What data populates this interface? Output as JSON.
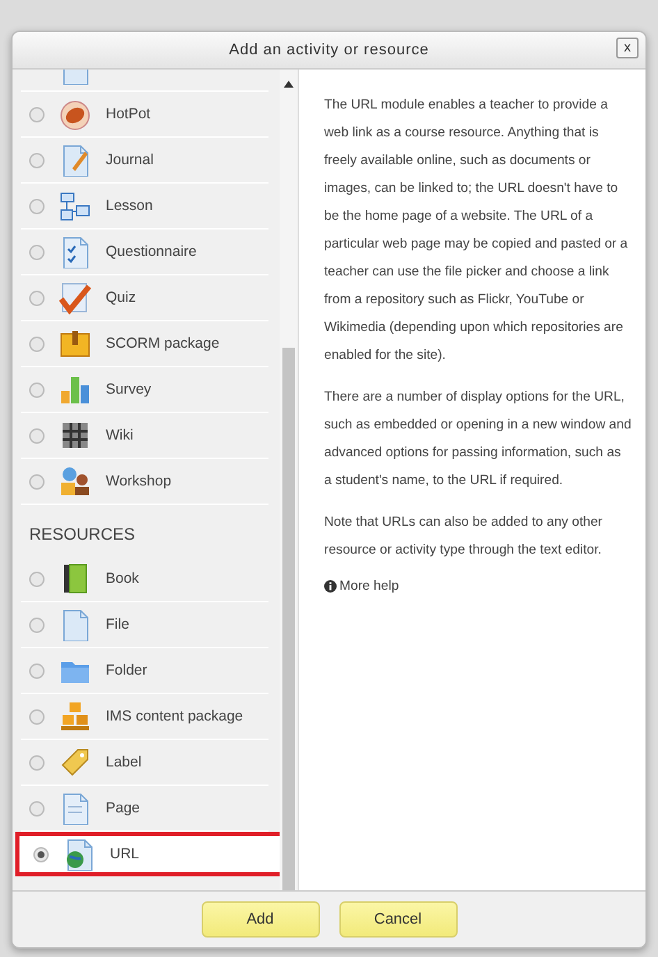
{
  "dialog": {
    "title": "Add an activity or resource",
    "close": "x"
  },
  "activities": {
    "items": [
      {
        "label": "HotPot",
        "selected": false
      },
      {
        "label": "Journal",
        "selected": false
      },
      {
        "label": "Lesson",
        "selected": false
      },
      {
        "label": "Questionnaire",
        "selected": false
      },
      {
        "label": "Quiz",
        "selected": false
      },
      {
        "label": "SCORM package",
        "selected": false
      },
      {
        "label": "Survey",
        "selected": false
      },
      {
        "label": "Wiki",
        "selected": false
      },
      {
        "label": "Workshop",
        "selected": false
      }
    ]
  },
  "resources": {
    "heading": "RESOURCES",
    "items": [
      {
        "label": "Book",
        "selected": false
      },
      {
        "label": "File",
        "selected": false
      },
      {
        "label": "Folder",
        "selected": false
      },
      {
        "label": "IMS content package",
        "selected": false
      },
      {
        "label": "Label",
        "selected": false
      },
      {
        "label": "Page",
        "selected": false
      },
      {
        "label": "URL",
        "selected": true
      }
    ]
  },
  "help": {
    "paragraphs": [
      "The URL module enables a teacher to provide a web link as a course resource. Anything that is freely available online, such as documents or images, can be linked to; the URL doesn't have to be the home page of a website. The URL of a particular web page may be copied and pasted or a teacher can use the file picker and choose a link from a repository such as Flickr, YouTube or Wikimedia (depending upon which repositories are enabled for the site).",
      "There are a number of display options for the URL, such as embedded or opening in a new window and advanced options for passing information, such as a student's name, to the URL if required.",
      "Note that URLs can also be added to any other resource or activity type through the text editor."
    ],
    "more_help": "More help"
  },
  "buttons": [
    "Add",
    "Cancel"
  ]
}
